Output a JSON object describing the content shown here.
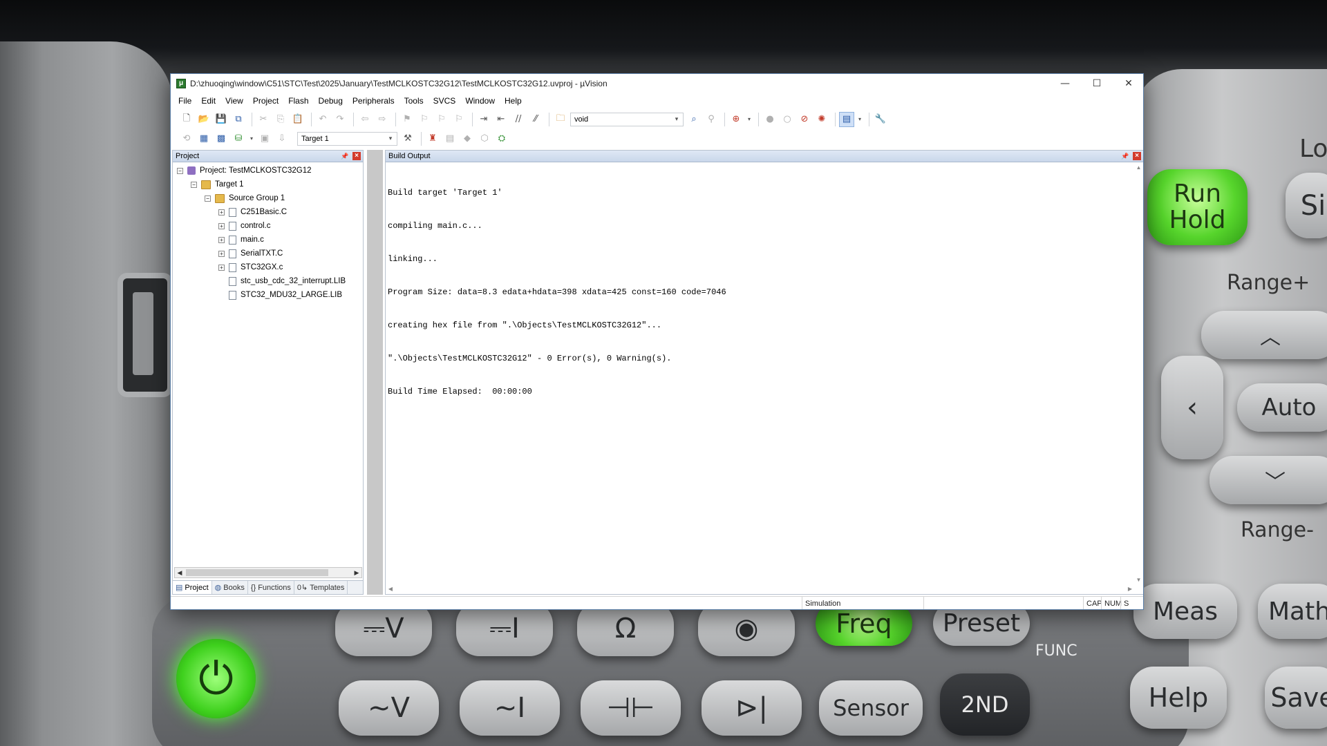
{
  "window": {
    "title": "D:\\zhuoqing\\window\\C51\\STC\\Test\\2025\\January\\TestMCLKOSTC32G12\\TestMCLKOSTC32G12.uvproj - µVision",
    "controls": {
      "minimize": "—",
      "maximize": "☐",
      "close": "✕"
    }
  },
  "menu": [
    "File",
    "Edit",
    "View",
    "Project",
    "Flash",
    "Debug",
    "Peripherals",
    "Tools",
    "SVCS",
    "Window",
    "Help"
  ],
  "toolbar": {
    "find_combo_value": "void",
    "target_combo_value": "Target 1"
  },
  "project_panel": {
    "title": "Project",
    "tree": {
      "project": "Project: TestMCLKOSTC32G12",
      "target": "Target 1",
      "group": "Source Group 1",
      "files": [
        "C251Basic.C",
        "control.c",
        "main.c",
        "SerialTXT.C",
        "STC32GX.c",
        "stc_usb_cdc_32_interrupt.LIB",
        "STC32_MDU32_LARGE.LIB"
      ]
    },
    "tabs": [
      "Project",
      "Books",
      "Functions",
      "Templates"
    ]
  },
  "build_output": {
    "title": "Build Output",
    "lines": [
      "Build target 'Target 1'",
      "compiling main.c...",
      "linking...",
      "Program Size: data=8.3 edata+hdata=398 xdata=425 const=160 code=7046",
      "creating hex file from \".\\Objects\\TestMCLKOSTC32G12\"...",
      "\".\\Objects\\TestMCLKOSTC32G12\" - 0 Error(s), 0 Warning(s).",
      "Build Time Elapsed:  00:00:00"
    ]
  },
  "statusbar": {
    "mode": "Simulation",
    "cap": "CAP",
    "num": "NUM",
    "scrl": "S"
  },
  "wallpaper": {
    "keys": [
      "Run",
      "Hold",
      "Range+",
      "Auto",
      "Range-",
      "Meas",
      "Math",
      "Help",
      "Save",
      "Sensor",
      "2ND",
      "Preset",
      "Freq",
      "FUNC",
      "Lo",
      "Si"
    ]
  }
}
